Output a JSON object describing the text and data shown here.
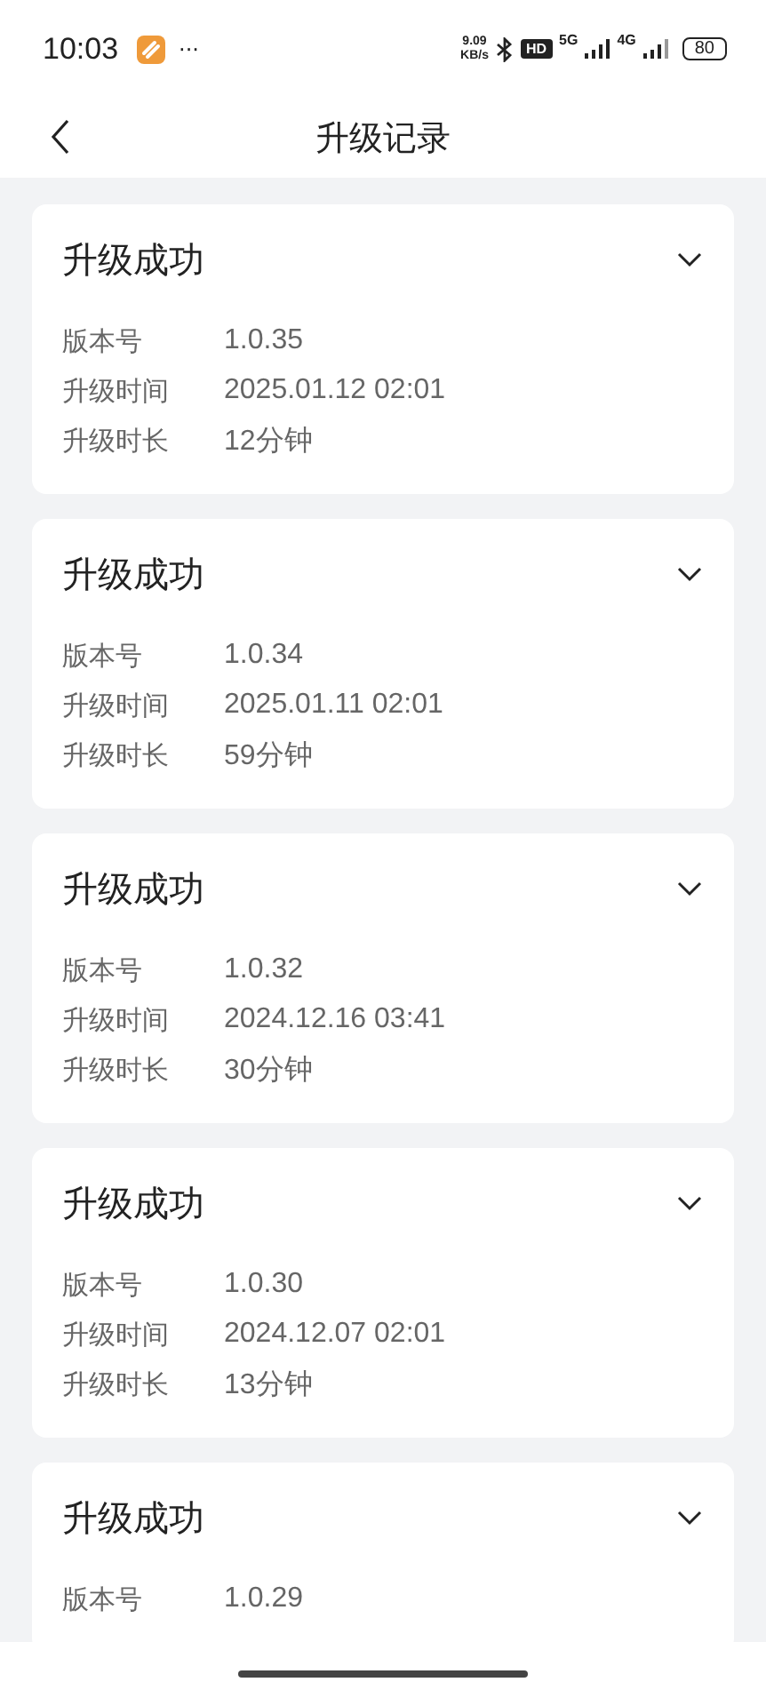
{
  "status_bar": {
    "time": "10:03",
    "more": "···",
    "speed_value": "9.09",
    "speed_unit": "KB/s",
    "hd": "HD",
    "network_1": "5G",
    "network_2": "4G",
    "battery": "80"
  },
  "header": {
    "title": "升级记录"
  },
  "records": [
    {
      "status": "升级成功",
      "fields": [
        {
          "label": "版本号",
          "value": "1.0.35"
        },
        {
          "label": "升级时间",
          "value": "2025.01.12 02:01"
        },
        {
          "label": "升级时长",
          "value": "12分钟"
        }
      ]
    },
    {
      "status": "升级成功",
      "fields": [
        {
          "label": "版本号",
          "value": "1.0.34"
        },
        {
          "label": "升级时间",
          "value": "2025.01.11 02:01"
        },
        {
          "label": "升级时长",
          "value": "59分钟"
        }
      ]
    },
    {
      "status": "升级成功",
      "fields": [
        {
          "label": "版本号",
          "value": "1.0.32"
        },
        {
          "label": "升级时间",
          "value": "2024.12.16 03:41"
        },
        {
          "label": "升级时长",
          "value": "30分钟"
        }
      ]
    },
    {
      "status": "升级成功",
      "fields": [
        {
          "label": "版本号",
          "value": "1.0.30"
        },
        {
          "label": "升级时间",
          "value": "2024.12.07 02:01"
        },
        {
          "label": "升级时长",
          "value": "13分钟"
        }
      ]
    },
    {
      "status": "升级成功",
      "fields": [
        {
          "label": "版本号",
          "value": "1.0.29"
        }
      ]
    }
  ]
}
